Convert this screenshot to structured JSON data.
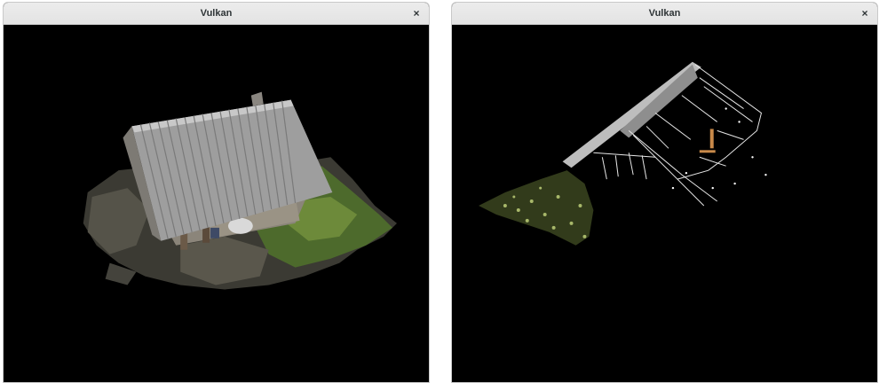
{
  "windows": [
    {
      "title": "Vulkan",
      "close_icon": "close-icon",
      "content": "textured 3D reconstruction of a stone hut with metal roof"
    },
    {
      "title": "Vulkan",
      "close_icon": "close-icon",
      "content": "sparse point cloud rendering of the same hut"
    }
  ],
  "close_glyph": "×",
  "colors": {
    "titlebar": "#e8e8e8",
    "viewport_bg": "#000000",
    "title_text": "#2e3436"
  }
}
